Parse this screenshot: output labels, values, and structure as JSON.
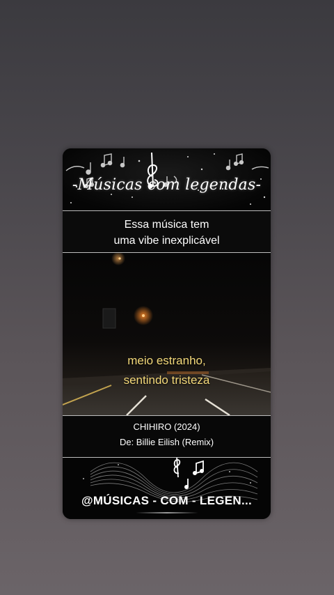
{
  "header": {
    "title": "-Músicas com legendas-"
  },
  "intro": {
    "line1": "Essa música tem",
    "line2": "uma vibe inexplicável"
  },
  "lyrics": {
    "line1": "meio estranho,",
    "line2": "sentindo tristeza"
  },
  "song": {
    "title": "CHIHIRO (2024)",
    "artist": "De: Billie Eilish (Remix)"
  },
  "footer": {
    "handle": "@MÚSICAS - COM - LEGEN..."
  },
  "icons": [
    "music-notes-icon",
    "treble-clef-icon",
    "sound-wave-icon"
  ],
  "colors": {
    "lyric_text": "#f4d97a",
    "card_bg": "#0a0a0a",
    "page_bg": "#4a474c"
  }
}
